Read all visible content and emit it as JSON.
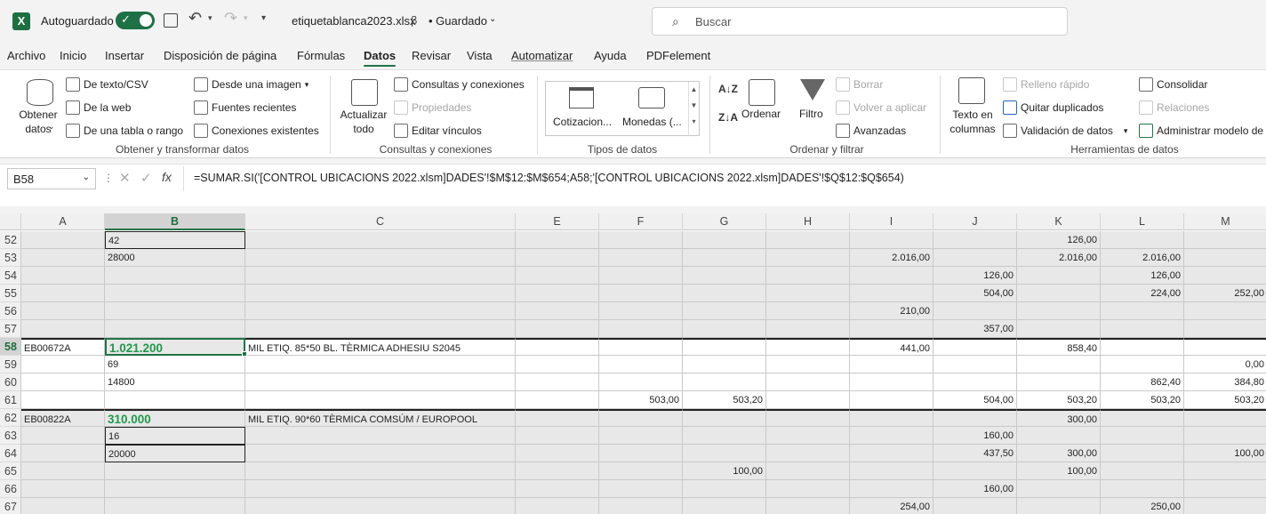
{
  "titlebar": {
    "autosave_label": "Autoguardado",
    "filename": "etiquetablanca2023.xlsx",
    "saved_label": "• Guardado",
    "search_placeholder": "Buscar"
  },
  "tabs": [
    "Archivo",
    "Inicio",
    "Insertar",
    "Disposición de página",
    "Fórmulas",
    "Datos",
    "Revisar",
    "Vista",
    "Automatizar",
    "Ayuda",
    "PDFelement"
  ],
  "active_tab": "Datos",
  "ribbon": {
    "get_data": "Obtener datos",
    "from_text": "De texto/CSV",
    "from_web": "De la web",
    "from_table": "De una tabla o rango",
    "from_image": "Desde una imagen",
    "recent_sources": "Fuentes recientes",
    "existing_connections": "Conexiones existentes",
    "group_get": "Obtener y transformar datos",
    "refresh_all": "Actualizar todo",
    "queries_connections": "Consultas y conexiones",
    "properties": "Propiedades",
    "edit_links": "Editar vínculos",
    "group_queries": "Consultas y conexiones",
    "stocks": "Cotizacion...",
    "currencies": "Monedas (...",
    "group_types": "Tipos de datos",
    "sort": "Ordenar",
    "filter": "Filtro",
    "clear": "Borrar",
    "reapply": "Volver a aplicar",
    "advanced": "Avanzadas",
    "group_sort": "Ordenar y filtrar",
    "text_to_columns": "Texto en columnas",
    "flash_fill": "Relleno rápido",
    "remove_duplicates": "Quitar duplicados",
    "data_validation": "Validación de datos",
    "consolidate": "Consolidar",
    "relationships": "Relaciones",
    "data_model": "Administrar modelo de",
    "group_tools": "Herramientas de datos"
  },
  "formula_bar": {
    "name_box": "B58",
    "fx": "fx",
    "formula": "=SUMAR.SI('[CONTROL UBICACIONS 2022.xlsm]DADES'!$M$12:$M$654;A58;'[CONTROL UBICACIONS 2022.xlsm]DADES'!$Q$12:$Q$654)"
  },
  "columns": [
    "A",
    "B",
    "C",
    "E",
    "F",
    "G",
    "H",
    "I",
    "J",
    "K",
    "L",
    "M"
  ],
  "rows": [
    {
      "n": "52",
      "A": "",
      "B": "42",
      "C": "",
      "E": "",
      "F": "",
      "G": "",
      "H": "",
      "I": "",
      "J": "",
      "K": "126,00",
      "L": "",
      "M": ""
    },
    {
      "n": "53",
      "A": "",
      "B": "28000",
      "C": "",
      "E": "",
      "F": "",
      "G": "",
      "H": "",
      "I": "2.016,00",
      "J": "",
      "K": "2.016,00",
      "L": "2.016,00",
      "M": ""
    },
    {
      "n": "54",
      "A": "",
      "B": "",
      "C": "",
      "E": "",
      "F": "",
      "G": "",
      "H": "",
      "I": "",
      "J": "126,00",
      "K": "",
      "L": "126,00",
      "M": ""
    },
    {
      "n": "55",
      "A": "",
      "B": "",
      "C": "",
      "E": "",
      "F": "",
      "G": "",
      "H": "",
      "I": "",
      "J": "504,00",
      "K": "",
      "L": "224,00",
      "M": "252,00"
    },
    {
      "n": "56",
      "A": "",
      "B": "",
      "C": "",
      "E": "",
      "F": "",
      "G": "",
      "H": "",
      "I": "210,00",
      "J": "",
      "K": "",
      "L": "",
      "M": ""
    },
    {
      "n": "57",
      "A": "",
      "B": "",
      "C": "",
      "E": "",
      "F": "",
      "G": "",
      "H": "",
      "I": "",
      "J": "357,00",
      "K": "",
      "L": "",
      "M": ""
    },
    {
      "n": "58",
      "A": "EB00672A",
      "B": "1.021.200",
      "C": "MIL ETIQ. 85*50 BL. TÈRMICA ADHESIU S2045",
      "E": "",
      "F": "",
      "G": "",
      "H": "",
      "I": "441,00",
      "J": "",
      "K": "858,40",
      "L": "",
      "M": ""
    },
    {
      "n": "59",
      "A": "",
      "B": "69",
      "C": "",
      "E": "",
      "F": "",
      "G": "",
      "H": "",
      "I": "",
      "J": "",
      "K": "",
      "L": "",
      "M": "0,00"
    },
    {
      "n": "60",
      "A": "",
      "B": "14800",
      "C": "",
      "E": "",
      "F": "",
      "G": "",
      "H": "",
      "I": "",
      "J": "",
      "K": "",
      "L": "862,40",
      "M": "384,80"
    },
    {
      "n": "61",
      "A": "",
      "B": "",
      "C": "",
      "E": "",
      "F": "503,00",
      "G": "503,20",
      "H": "",
      "I": "",
      "J": "504,00",
      "K": "503,20",
      "L": "503,20",
      "M": "503,20"
    },
    {
      "n": "62",
      "A": "EB00822A",
      "B": "310.000",
      "C": "MIL ETIQ. 90*60 TÈRMICA COMSÚM / EUROPOOL",
      "E": "",
      "F": "",
      "G": "",
      "H": "",
      "I": "",
      "J": "",
      "K": "300,00",
      "L": "",
      "M": ""
    },
    {
      "n": "63",
      "A": "",
      "B": "16",
      "C": "",
      "E": "",
      "F": "",
      "G": "",
      "H": "",
      "I": "",
      "J": "160,00",
      "K": "",
      "L": "",
      "M": ""
    },
    {
      "n": "64",
      "A": "",
      "B": "20000",
      "C": "",
      "E": "",
      "F": "",
      "G": "",
      "H": "",
      "I": "",
      "J": "437,50",
      "K": "300,00",
      "L": "",
      "M": "100,00"
    },
    {
      "n": "65",
      "A": "",
      "B": "",
      "C": "",
      "E": "",
      "F": "",
      "G": "100,00",
      "H": "",
      "I": "",
      "J": "",
      "K": "100,00",
      "L": "",
      "M": ""
    },
    {
      "n": "66",
      "A": "",
      "B": "",
      "C": "",
      "E": "",
      "F": "",
      "G": "",
      "H": "",
      "I": "",
      "J": "160,00",
      "K": "",
      "L": "",
      "M": ""
    },
    {
      "n": "67",
      "A": "",
      "B": "",
      "C": "",
      "E": "",
      "F": "",
      "G": "",
      "H": "",
      "I": "254,00",
      "J": "",
      "K": "",
      "L": "250,00",
      "M": ""
    }
  ],
  "accent_color": "#217346"
}
